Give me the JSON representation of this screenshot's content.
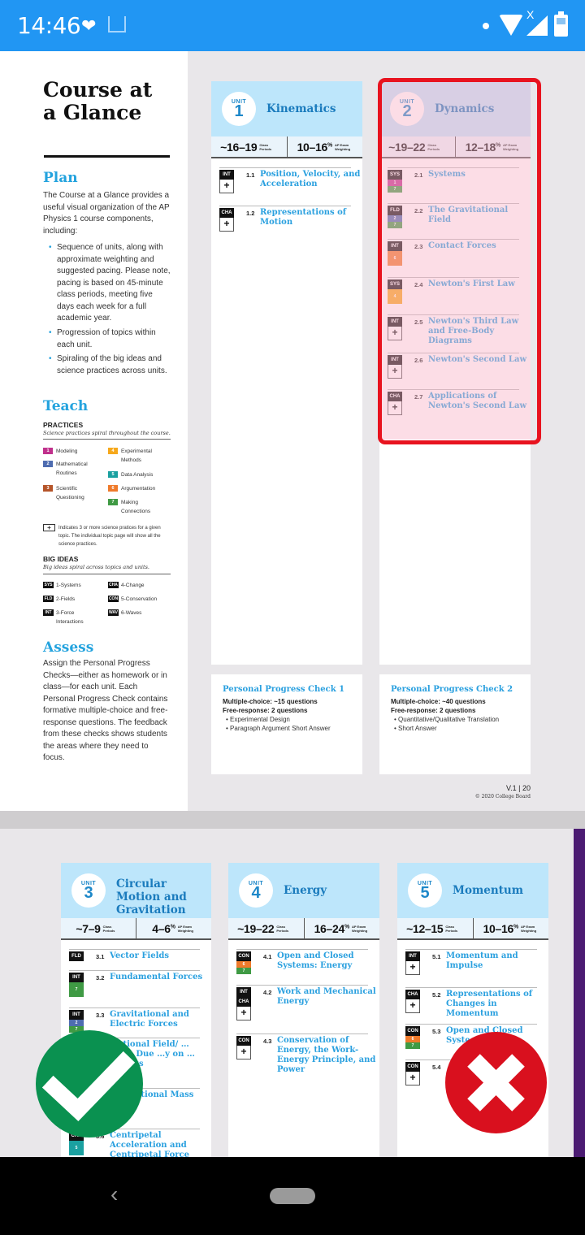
{
  "status_bar": {
    "time": "14:46",
    "icons": [
      "heart-check-icon",
      "tray-icon",
      "dot-icon",
      "wifi-icon",
      "no-data-x-icon",
      "signal-icon",
      "battery-icon"
    ]
  },
  "page1": {
    "title_line1": "Course at",
    "title_line2": "a Glance",
    "plan": {
      "heading": "Plan",
      "intro": "The Course at a Glance provides a useful visual organization of the AP Physics 1 course components, including:",
      "bullets": [
        "Sequence of units, along with approximate weighting and suggested pacing. Please note, pacing is based on 45-minute class periods, meeting five days each week for a full academic year.",
        "Progression of topics within each unit.",
        "Spiraling of the big ideas and science practices across units."
      ]
    },
    "teach": {
      "heading": "Teach",
      "practices_heading": "PRACTICES",
      "practices_sub": "Science practices spiral throughout the course.",
      "practices": [
        {
          "num": "1",
          "label": "Modeling",
          "color": "#c0308c"
        },
        {
          "num": "2",
          "label": "Mathematical Routines",
          "color": "#4e6cb0"
        },
        {
          "num": "3",
          "label": "Scientific Questioning",
          "color": "#b5552a"
        },
        {
          "num": "4",
          "label": "Experimental Methods",
          "color": "#f6a81b"
        },
        {
          "num": "5",
          "label": "Data Analysis",
          "color": "#1aa0a0"
        },
        {
          "num": "6",
          "label": "Argumentation",
          "color": "#ef7a2b"
        },
        {
          "num": "7",
          "label": "Making Connections",
          "color": "#3f9a44"
        }
      ],
      "plus_note": "Indicates 3 or more science pratices for a given topic. The individual topic page will show all the science practices.",
      "plus_symbol": "+",
      "big_ideas_heading": "BIG IDEAS",
      "big_ideas_sub": "Big ideas spiral across topics and units.",
      "big_ideas": [
        {
          "tag": "SYS",
          "label": "1-Systems"
        },
        {
          "tag": "FLD",
          "label": "2-Fields"
        },
        {
          "tag": "INT",
          "label": "3-Force Interactions"
        },
        {
          "tag": "CHA",
          "label": "4-Change"
        },
        {
          "tag": "CON",
          "label": "5-Conservation"
        },
        {
          "tag": "WAV",
          "label": "6-Waves"
        }
      ]
    },
    "assess": {
      "heading": "Assess",
      "text": "Assign the Personal Progress Checks—either as homework or in class—for each unit. Each Personal Progress Check contains formative multiple-choice and free-response questions. The feedback from these checks shows students the areas where they need to focus."
    },
    "units": [
      {
        "unit_label": "UNIT",
        "number": "1",
        "name": "Kinematics",
        "periods": "~16–19",
        "periods_label": "Class Periods",
        "weight": "10–16",
        "weight_suffix": "%",
        "weight_label": "AP Exam Weighting",
        "topics": [
          {
            "num": "1.1",
            "name": "Position, Velocity, and Acceleration",
            "tags": [
              "INT"
            ],
            "practices": [],
            "plus": true
          },
          {
            "num": "1.2",
            "name": "Representations of Motion",
            "tags": [
              "CHA"
            ],
            "practices": [],
            "plus": true
          }
        ]
      },
      {
        "unit_label": "UNIT",
        "number": "2",
        "name": "Dynamics",
        "periods": "~19–22",
        "periods_label": "Class Periods",
        "weight": "12–18",
        "weight_suffix": "%",
        "weight_label": "AP Exam Weighting",
        "topics": [
          {
            "num": "2.1",
            "name": "Systems",
            "tags": [
              "SYS"
            ],
            "practices": [
              "1",
              "7"
            ],
            "plus": false
          },
          {
            "num": "2.2",
            "name": "The Gravitational Field",
            "tags": [
              "FLD"
            ],
            "practices": [
              "2",
              "7"
            ],
            "plus": false
          },
          {
            "num": "2.3",
            "name": "Contact Forces",
            "tags": [
              "INT"
            ],
            "practices": [
              "6"
            ],
            "plus": false
          },
          {
            "num": "2.4",
            "name": "Newton's First Law",
            "tags": [
              "SYS"
            ],
            "practices": [
              "4"
            ],
            "plus": false
          },
          {
            "num": "2.5",
            "name": "Newton's Third Law and Free-Body Diagrams",
            "tags": [
              "INT"
            ],
            "practices": [],
            "plus": true
          },
          {
            "num": "2.6",
            "name": "Newton's Second Law",
            "tags": [
              "INT"
            ],
            "practices": [],
            "plus": true
          },
          {
            "num": "2.7",
            "name": "Applications of Newton's Second Law",
            "tags": [
              "CHA"
            ],
            "practices": [],
            "plus": true
          }
        ]
      }
    ],
    "progress_checks": [
      {
        "title": "Personal Progress Check 1",
        "mc": "Multiple-choice: ~15 questions",
        "fr": "Free-response: 2 questions",
        "items": [
          "Experimental Design",
          "Paragraph Argument Short Answer"
        ]
      },
      {
        "title": "Personal Progress Check 2",
        "mc": "Multiple-choice: ~40 questions",
        "fr": "Free-response: 2 questions",
        "items": [
          "Quantitative/Qualitative Translation",
          "Short Answer"
        ]
      }
    ],
    "footer_version": "V.1  |  20",
    "footer_copyright": "© 2020 College Board"
  },
  "page2": {
    "units": [
      {
        "unit_label": "UNIT",
        "number": "3",
        "name": "Circular Motion and Gravitation",
        "periods": "~7–9",
        "periods_label": "Class Periods",
        "weight": "4–6",
        "weight_suffix": "%",
        "weight_label": "AP Exam Weighting",
        "topics": [
          {
            "num": "3.1",
            "name": "Vector Fields",
            "tags": [
              "FLD"
            ],
            "practices": [],
            "plus": false
          },
          {
            "num": "3.2",
            "name": "Fundamental Forces",
            "tags": [
              "INT"
            ],
            "practices": [
              "7"
            ],
            "plus": false
          },
          {
            "num": "3.3",
            "name": "Gravitational and Electric Forces",
            "tags": [
              "INT"
            ],
            "practices": [
              "2",
              "7"
            ],
            "plus": false
          },
          {
            "num": "3.4",
            "name": "…ational Field/ …ation Due …y on … Planets",
            "tags": [],
            "practices": [],
            "plus": false
          },
          {
            "num": "3.5",
            "name": "…vs. …tional Mass",
            "tags": [],
            "practices": [],
            "plus": false
          },
          {
            "num": "3.6",
            "name": "Centripetal Acceleration and Centripetal Force",
            "tags": [
              "CHA"
            ],
            "practices": [
              "5"
            ],
            "plus": false
          }
        ]
      },
      {
        "unit_label": "UNIT",
        "number": "4",
        "name": "Energy",
        "periods": "~19–22",
        "periods_label": "Class Periods",
        "weight": "16–24",
        "weight_suffix": "%",
        "weight_label": "AP Exam Weighting",
        "topics": [
          {
            "num": "4.1",
            "name": "Open and Closed Systems: Energy",
            "tags": [
              "CON"
            ],
            "practices": [
              "6",
              "7"
            ],
            "plus": false
          },
          {
            "num": "4.2",
            "name": "Work and Mechanical Energy",
            "tags": [
              "INT",
              "CHA"
            ],
            "practices": [],
            "plus": true
          },
          {
            "num": "4.3",
            "name": "Conservation of Energy, the Work-Energy Principle, and Power",
            "tags": [
              "CON"
            ],
            "practices": [],
            "plus": true
          }
        ]
      },
      {
        "unit_label": "UNIT",
        "number": "5",
        "name": "Momentum",
        "periods": "~12–15",
        "periods_label": "Class Periods",
        "weight": "10–16",
        "weight_suffix": "%",
        "weight_label": "AP Exam Weighting",
        "topics": [
          {
            "num": "5.1",
            "name": "Momentum and Impulse",
            "tags": [
              "INT"
            ],
            "practices": [],
            "plus": true
          },
          {
            "num": "5.2",
            "name": "Representations of Changes in Momentum",
            "tags": [
              "CHA"
            ],
            "practices": [],
            "plus": true
          },
          {
            "num": "5.3",
            "name": "Open and Closed Syste…",
            "tags": [
              "CON"
            ],
            "practices": [
              "6",
              "7"
            ],
            "plus": false
          },
          {
            "num": "5.4",
            "name": "",
            "tags": [
              "CON"
            ],
            "practices": [],
            "plus": true
          }
        ]
      }
    ]
  },
  "overlays": {
    "approve_icon": "check-icon",
    "reject_icon": "cross-icon",
    "approve_color": "#0a9150",
    "reject_color": "#d9101e",
    "highlight_color": "#e8131f"
  },
  "nav_bar": {
    "back_symbol": "‹"
  }
}
